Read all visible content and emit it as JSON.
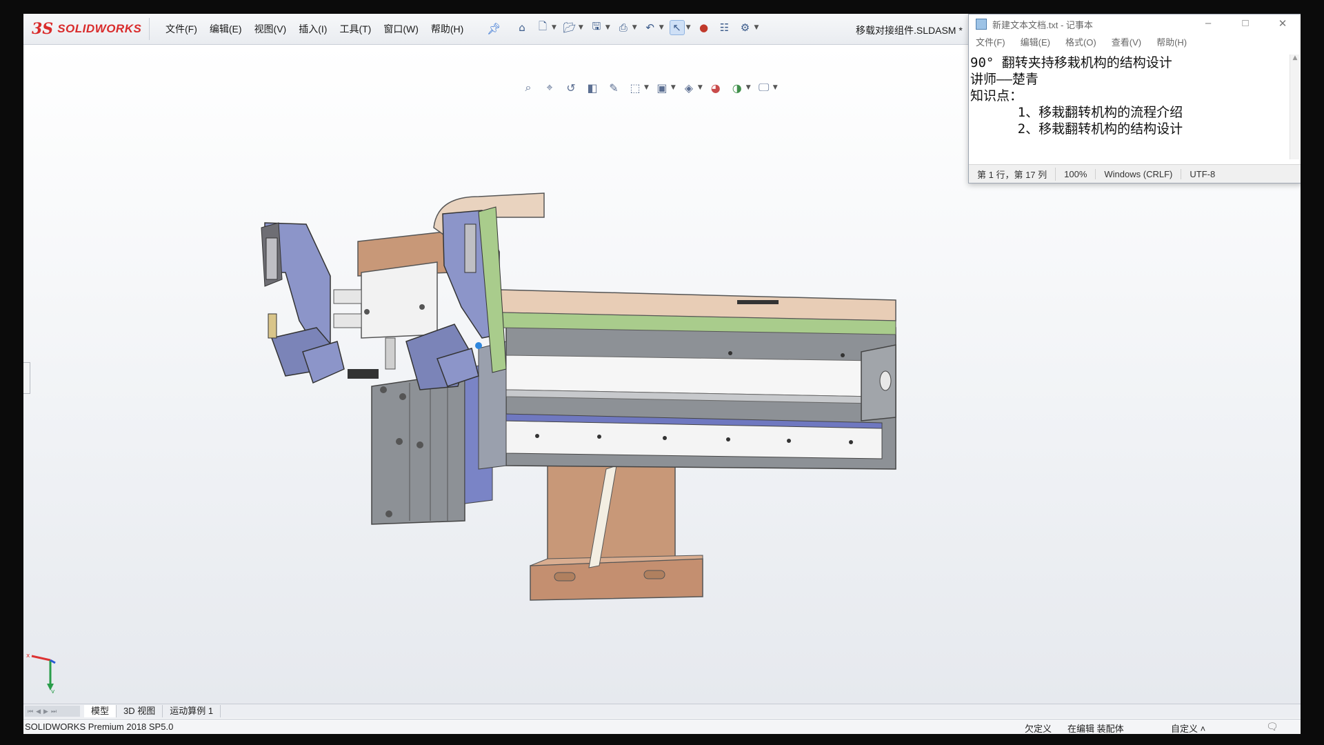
{
  "app": {
    "logo_mark": "3S",
    "logo_text": "SOLIDWORKS",
    "document_title": "移载对接组件.SLDASM *"
  },
  "menu": {
    "items": [
      "文件(F)",
      "编辑(E)",
      "视图(V)",
      "插入(I)",
      "工具(T)",
      "窗口(W)",
      "帮助(H)"
    ]
  },
  "toolbar": {
    "icons": [
      "home-icon",
      "new-file-icon",
      "open-icon",
      "save-icon",
      "print-icon",
      "undo-icon",
      "select-cursor-icon",
      "traffic-light-icon",
      "file-properties-icon",
      "options-gear-icon"
    ]
  },
  "view_toolbar": {
    "icons": [
      "zoom-to-fit-icon",
      "zoom-area-icon",
      "previous-view-icon",
      "section-view-icon",
      "dynamic-annotation-icon",
      "view-orientation-icon",
      "display-style-icon",
      "hide-show-icon",
      "edit-appearance-icon",
      "apply-scene-icon",
      "view-settings-icon"
    ]
  },
  "notepad": {
    "title": "新建文本文档.txt - 记事本",
    "menu": [
      "文件(F)",
      "编辑(E)",
      "格式(O)",
      "查看(V)",
      "帮助(H)"
    ],
    "lines": [
      "90° 翻转夹持移栽机构的结构设计",
      "讲师——楚青",
      "知识点：",
      "      1、移栽翻转机构的流程介绍",
      "      2、移栽翻转机构的结构设计"
    ],
    "status": {
      "position": "第 1 行，第 17 列",
      "zoom": "100%",
      "line_ending": "Windows (CRLF)",
      "encoding": "UTF-8"
    }
  },
  "tabs": [
    "模型",
    "3D 视图",
    "运动算例 1"
  ],
  "status_bar": {
    "version": "SOLIDWORKS Premium 2018 SP5.0",
    "underdefined": "欠定义",
    "editing": "在编辑 装配体",
    "custom": "自定义"
  },
  "colors": {
    "brand_red": "#d92b2b",
    "part_blue": "#8c95c9",
    "part_grey": "#8d9196",
    "part_brown": "#c89878",
    "part_green": "#a9cc8c",
    "viewport_bg": "#f1f3f6"
  }
}
